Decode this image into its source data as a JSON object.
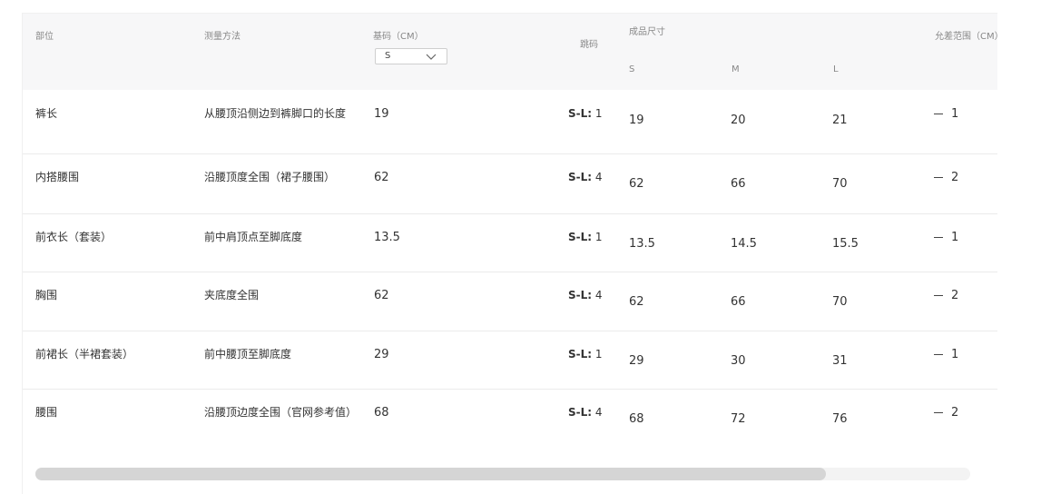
{
  "header": {
    "part": "部位",
    "method": "测量方法",
    "base_size": "基码（CM）",
    "step": "跳码",
    "finished": "成品尺寸",
    "tolerance": "允差范围（CM）",
    "size_select_value": "S",
    "sizes": [
      "S",
      "M",
      "L"
    ]
  },
  "rows": [
    {
      "part": "裤长",
      "method": "从腰顶沿侧边到裤脚口的长度",
      "base": "19",
      "step_label": "S-L:",
      "step_value": "1",
      "s": "19",
      "m": "20",
      "l": "21",
      "tol": "1"
    },
    {
      "part": "内搭腰围",
      "method": "沿腰顶度全围（裙子腰围）",
      "base": "62",
      "step_label": "S-L:",
      "step_value": "4",
      "s": "62",
      "m": "66",
      "l": "70",
      "tol": "2"
    },
    {
      "part": "前衣长（套装）",
      "method": "前中肩顶点至脚底度",
      "base": "13.5",
      "step_label": "S-L:",
      "step_value": "1",
      "s": "13.5",
      "m": "14.5",
      "l": "15.5",
      "tol": "1"
    },
    {
      "part": "胸围",
      "method": "夹底度全围",
      "base": "62",
      "step_label": "S-L:",
      "step_value": "4",
      "s": "62",
      "m": "66",
      "l": "70",
      "tol": "2"
    },
    {
      "part": "前裙长（半裙套装）",
      "method": "前中腰顶至脚底度",
      "base": "29",
      "step_label": "S-L:",
      "step_value": "1",
      "s": "29",
      "m": "30",
      "l": "31",
      "tol": "1"
    },
    {
      "part": "腰围",
      "method": "沿腰顶边度全围（官网参考值）",
      "base": "68",
      "step_label": "S-L:",
      "step_value": "4",
      "s": "68",
      "m": "72",
      "l": "76",
      "tol": "2"
    }
  ],
  "scrollbar": {
    "position_fraction": 0.85
  }
}
